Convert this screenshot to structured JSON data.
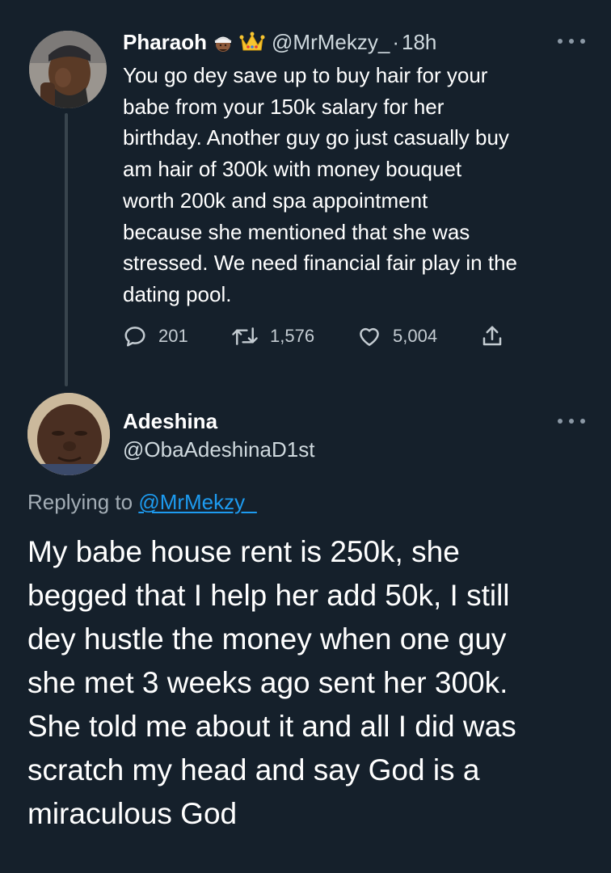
{
  "parent_tweet": {
    "author_name": "Pharaoh",
    "author_emojis": [
      "person-wearing-turban-emoji",
      "crown-emoji"
    ],
    "handle": "@MrMekzy_",
    "separator": "·",
    "time": "18h",
    "more_icon": "more-horizontal-icon",
    "text_lines": [
      "You go dey save up to buy hair for your",
      "babe from your 150k salary for her",
      "birthday. Another guy go just casually buy",
      "am hair of 300k with money bouquet",
      "worth 200k and spa appointment",
      "because she mentioned that she was",
      "stressed. We need financial fair play in the",
      "dating pool."
    ],
    "actions": {
      "reply_count": "201",
      "retweet_count": "1,576",
      "like_count": "5,004"
    }
  },
  "reply_tweet": {
    "author_name": "Adeshina",
    "handle": "@ObaAdeshinaD1st",
    "more_icon": "more-horizontal-icon",
    "replying_prefix": "Replying to",
    "replying_to": "@MrMekzy_",
    "text_lines": [
      "My babe house rent is 250k, she",
      "begged that I help her add 50k, I still",
      "dey hustle the money when one guy",
      "she met 3 weeks ago sent her 300k.",
      "She told me about it and all I did was",
      "scratch my head and say God is a",
      "miraculous God"
    ]
  },
  "colors": {
    "background": "#15202b",
    "text_primary": "#ffffff",
    "text_secondary": "#8b98a5",
    "link": "#1d9bf0",
    "thread_line": "#38444d"
  }
}
